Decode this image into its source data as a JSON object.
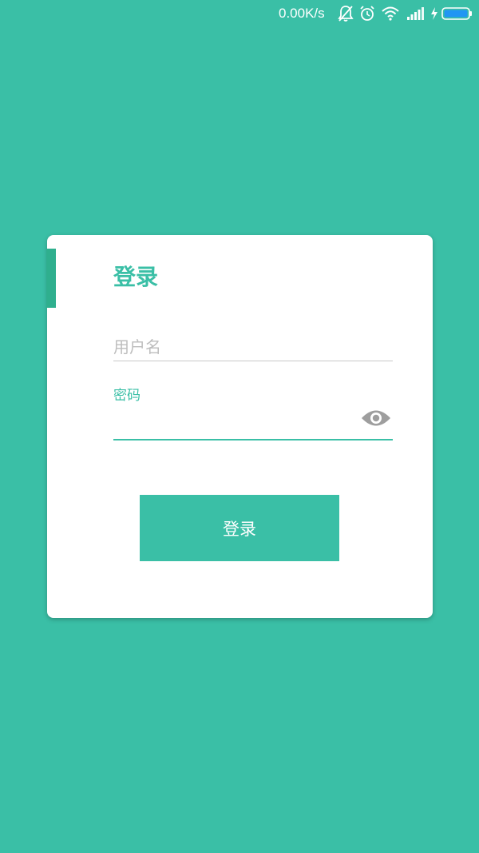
{
  "status_bar": {
    "network_speed": "0.00K/s",
    "icons": [
      "bell-off-icon",
      "alarm-icon",
      "wifi-icon",
      "signal-icon",
      "charging-icon",
      "battery-icon"
    ],
    "battery_color": "#2196F3"
  },
  "login_card": {
    "title": "登录",
    "username": {
      "placeholder": "用户名",
      "value": ""
    },
    "password": {
      "label": "密码",
      "value": "",
      "toggle_icon": "eye-icon"
    },
    "submit_label": "登录"
  },
  "colors": {
    "background": "#3ABFA6",
    "accent": "#3ABFA6",
    "accent_bar": "#2FAF8E",
    "card": "#FFFFFF",
    "eye_icon": "#9E9E9E"
  }
}
